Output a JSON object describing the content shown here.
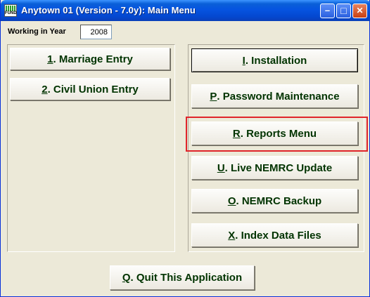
{
  "window": {
    "title": "Anytown 01 (Version - 7.0y):  Main Menu",
    "icon_label": "FUND"
  },
  "titlebar_buttons": {
    "minimize": "–",
    "maximize": "□",
    "close": "✕"
  },
  "working_year": {
    "label": "Working in Year",
    "value": "2008"
  },
  "left_menu": [
    {
      "key": "1",
      "label": ".  Marriage Entry"
    },
    {
      "key": "2",
      "label": ". Civil Union Entry"
    }
  ],
  "right_menu": [
    {
      "key": "I",
      "label": ". Installation"
    },
    {
      "key": "P",
      "label": ".  Password Maintenance"
    },
    {
      "key": "R",
      "label": ".  Reports Menu"
    },
    {
      "key": "U",
      "label": ". Live NEMRC Update"
    },
    {
      "key": "O",
      "label": ". NEMRC Backup"
    },
    {
      "key": "X",
      "label": ".  Index Data Files"
    }
  ],
  "quit": {
    "key": "Q",
    "label": ".  Quit This Application"
  },
  "highlight_color": "#e0242a"
}
